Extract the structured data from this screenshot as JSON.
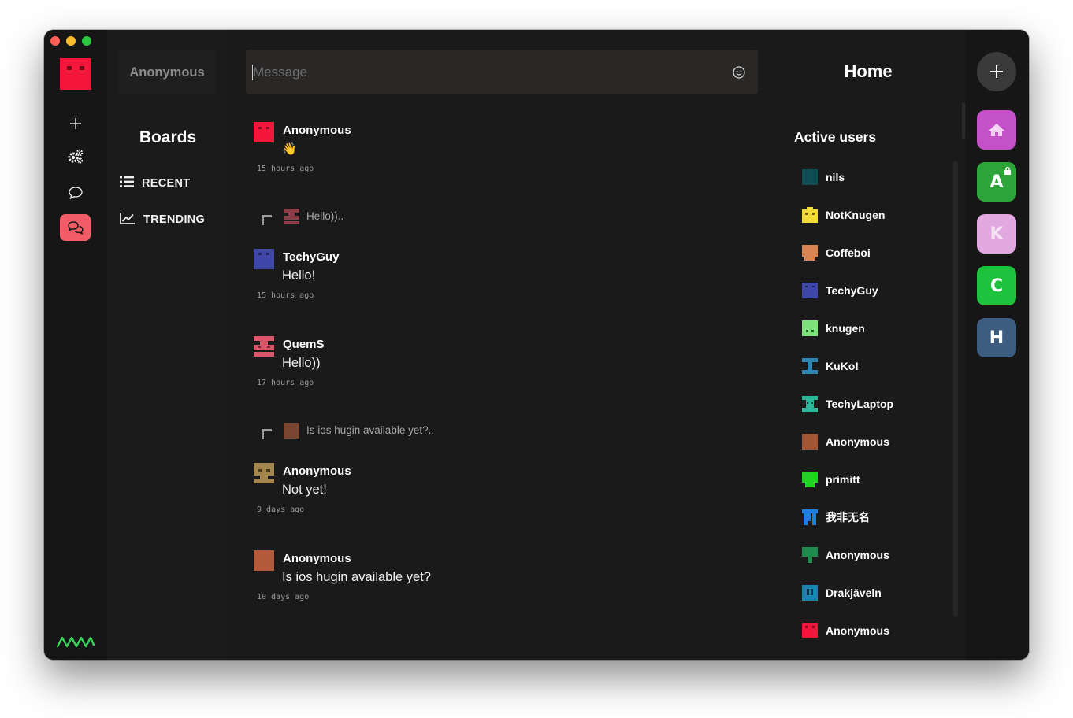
{
  "user": {
    "name": "Anonymous"
  },
  "message_input": {
    "placeholder": "Message"
  },
  "boards": {
    "title": "Boards",
    "items": [
      {
        "label": "RECENT",
        "icon": "list-icon"
      },
      {
        "label": "TRENDING",
        "icon": "trending-icon"
      }
    ]
  },
  "feed": {
    "posts": [
      {
        "nick": "Anonymous",
        "text": "👋",
        "time": "15 hours ago",
        "avatar_color": "#f4153b"
      },
      {
        "reply_to": "Hello))..",
        "reply_avatar_color": "#8b3d48",
        "nick": "TechyGuy",
        "text": "Hello!",
        "time": "15 hours ago",
        "avatar_color": "#3f47a8"
      },
      {
        "nick": "QuemS",
        "text": "Hello))",
        "time": "17 hours ago",
        "avatar_color": "#d9576a"
      },
      {
        "reply_to": "Is ios hugin available yet?..",
        "reply_avatar_color": "#7a4531",
        "nick": "Anonymous",
        "text": "Not yet!",
        "time": "9 days ago",
        "avatar_color": "#a3864e"
      },
      {
        "nick": "Anonymous",
        "text": "Is ios hugin available yet?",
        "time": "10 days ago",
        "avatar_color": "#b35a3a"
      }
    ]
  },
  "sidebar_right": {
    "title": "Home",
    "active_users_title": "Active users",
    "users": [
      {
        "name": "nils",
        "color": "#0f4d55"
      },
      {
        "name": "NotKnugen",
        "color": "#f2db36"
      },
      {
        "name": "Coffeboi",
        "color": "#d98453"
      },
      {
        "name": "TechyGuy",
        "color": "#3f47a8"
      },
      {
        "name": "knugen",
        "color": "#7ee27c"
      },
      {
        "name": "KuKo!",
        "color": "#2d86b3"
      },
      {
        "name": "TechyLaptop",
        "color": "#2bb79a"
      },
      {
        "name": "Anonymous",
        "color": "#a35635"
      },
      {
        "name": "primitt",
        "color": "#1fd31f"
      },
      {
        "name": "我非无名",
        "color": "#1f7fe0"
      },
      {
        "name": "Anonymous",
        "color": "#1e8a4e"
      },
      {
        "name": "Drakjäveln",
        "color": "#1984b0"
      },
      {
        "name": "Anonymous",
        "color": "#f4153b"
      }
    ]
  },
  "groups": [
    {
      "label": "A",
      "color": "#2ea53a",
      "locked": true
    },
    {
      "label": "K",
      "color": "#e2a8e0",
      "locked": false
    },
    {
      "label": "C",
      "color": "#1fc23c",
      "locked": false
    },
    {
      "label": "H",
      "color": "#3c5d80",
      "locked": false
    }
  ],
  "colors": {
    "accent": "#f25c66",
    "home_group": "#c551c9",
    "logo_green": "#3ad25a"
  }
}
